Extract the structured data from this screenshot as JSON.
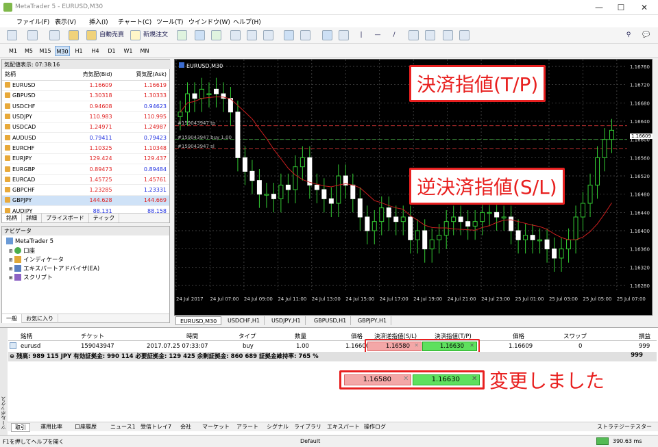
{
  "window": {
    "title": "MetaTrader 5 - EURUSD,M30"
  },
  "menu": [
    "ファイル(F)",
    "表示(V)",
    "挿入(I)",
    "チャート(C)",
    "ツール(T)",
    "ウインドウ(W)",
    "ヘルプ(H)"
  ],
  "toolbar": {
    "auto_trade": "自動売買",
    "new_order": "新規注文"
  },
  "timeframes": [
    "M1",
    "M5",
    "M15",
    "M30",
    "H1",
    "H4",
    "D1",
    "W1",
    "MN"
  ],
  "market_watch": {
    "header": "気配値表示: 07:38:16",
    "columns": [
      "銘柄",
      "売気配(Bid)",
      "買気配(Ask)"
    ],
    "rows": [
      {
        "symbol": "EURUSD",
        "bid": "1.16609",
        "ask": "1.16619",
        "color": "r"
      },
      {
        "symbol": "GBPUSD",
        "bid": "1.30318",
        "ask": "1.30333",
        "color": "r"
      },
      {
        "symbol": "USDCHF",
        "bid": "0.94608",
        "ask": "0.94623",
        "color": "rb"
      },
      {
        "symbol": "USDJPY",
        "bid": "110.983",
        "ask": "110.995",
        "color": "r"
      },
      {
        "symbol": "USDCAD",
        "bid": "1.24971",
        "ask": "1.24987",
        "color": "r"
      },
      {
        "symbol": "AUDUSD",
        "bid": "0.79411",
        "ask": "0.79423",
        "color": "b"
      },
      {
        "symbol": "EURCHF",
        "bid": "1.10325",
        "ask": "1.10348",
        "color": "r"
      },
      {
        "symbol": "EURJPY",
        "bid": "129.424",
        "ask": "129.437",
        "color": "r"
      },
      {
        "symbol": "EURGBP",
        "bid": "0.89473",
        "ask": "0.89484",
        "color": "rb"
      },
      {
        "symbol": "EURCAD",
        "bid": "1.45725",
        "ask": "1.45761",
        "color": "r"
      },
      {
        "symbol": "GBPCHF",
        "bid": "1.23285",
        "ask": "1.23331",
        "color": "rb"
      },
      {
        "symbol": "GBPJPY",
        "bid": "144.628",
        "ask": "144.669",
        "color": "r"
      },
      {
        "symbol": "AUDJPY",
        "bid": "88.131",
        "ask": "88.158",
        "color": "b"
      }
    ],
    "tabs": [
      "銘柄",
      "詳細",
      "プライスボード",
      "ティック"
    ]
  },
  "navigator": {
    "header": "ナビゲータ",
    "root": "MetaTrader 5",
    "items": [
      "口座",
      "インディケータ",
      "エキスパートアドバイザ(EA)",
      "スクリプト"
    ],
    "tabs": [
      "一般",
      "お気に入り"
    ]
  },
  "chart": {
    "label": "EURUSD,M30",
    "line_tp": "#159043947 tp",
    "line_buy": "#159043947 buy 1.00",
    "line_sl": "#159043947 sl",
    "y_labels": [
      "1.16760",
      "1.16720",
      "1.16680",
      "1.16640",
      "1.16600",
      "1.16560",
      "1.16520",
      "1.16480",
      "1.16440",
      "1.16400",
      "1.16360",
      "1.16320",
      "1.16280"
    ],
    "current_price": "1.16609",
    "x_labels": [
      "24 Jul 2017",
      "24 Jul 07:00",
      "24 Jul 09:00",
      "24 Jul 11:00",
      "24 Jul 13:00",
      "24 Jul 15:00",
      "24 Jul 17:00",
      "24 Jul 19:00",
      "24 Jul 21:00",
      "24 Jul 23:00",
      "25 Jul 01:00",
      "25 Jul 03:00",
      "25 Jul 05:00",
      "25 Jul 07:00"
    ],
    "callout_tp": "決済指値(T/P)",
    "callout_sl": "逆決済指値(S/L)"
  },
  "chart_tabs": [
    "EURUSD,M30",
    "USDCHF,H1",
    "USDJPY,H1",
    "GBPUSD,H1",
    "GBPJPY,H1"
  ],
  "trade": {
    "columns": [
      "銘柄",
      "チケット",
      "時間",
      "タイプ",
      "数量",
      "価格",
      "決済逆指値(S/L)",
      "決済指値(T/P)",
      "価格",
      "スワップ",
      "損益"
    ],
    "row": {
      "symbol": "eurusd",
      "ticket": "159043947",
      "time": "2017.07.25 07:33:07",
      "type": "buy",
      "volume": "1.00",
      "price": "1.16600",
      "sl": "1.16580",
      "tp": "1.16630",
      "cur_price": "1.16609",
      "swap": "0",
      "profit": "999"
    },
    "balance": "残高: 989 115 JPY  有効証拠金: 990 114  必要証拠金: 129 425  余剰証拠金: 860 689  証拠金維持率: 765 %",
    "balance_profit": "999",
    "edit_sl": "1.16580",
    "edit_tp": "1.16630",
    "changed_note": "変更しました"
  },
  "toolbox_label": "ツールボックス",
  "bottom_tabs": [
    "取引",
    "運用比率",
    "口座履歴",
    "ニュース1",
    "受信トレイ7",
    "会社",
    "マーケット",
    "アラート",
    "シグナル",
    "ライブラリ",
    "エキスパート",
    "操作ログ"
  ],
  "strategy_tester": "ストラテジーテスター",
  "status": {
    "help": "F1を押してヘルプを開く",
    "profile": "Default",
    "ping": "390.63 ms"
  }
}
